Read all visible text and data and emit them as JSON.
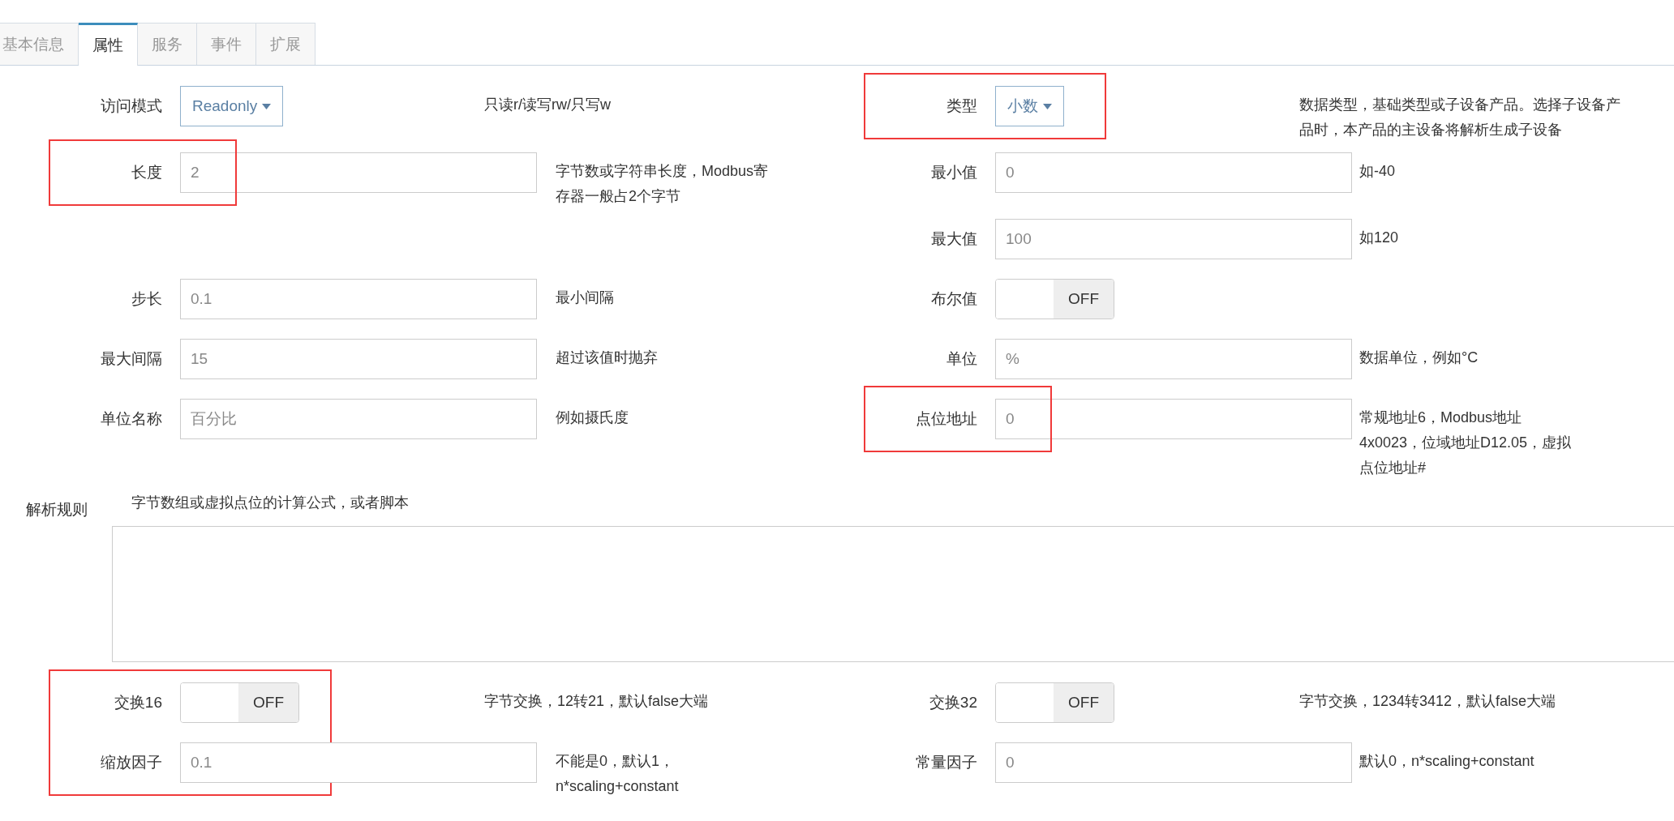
{
  "tabs": [
    {
      "label": "基本信息",
      "selected": false
    },
    {
      "label": "属性",
      "selected": true
    },
    {
      "label": "服务",
      "selected": false
    },
    {
      "label": "事件",
      "selected": false
    },
    {
      "label": "扩展",
      "selected": false
    }
  ],
  "fields_top": [
    {
      "left": {
        "kind": "select",
        "label": "访问模式",
        "value": "Readonly",
        "help": "只读r/读写rw/只写w",
        "highlighted": false
      },
      "right": {
        "kind": "select",
        "label": "类型",
        "value": "小数",
        "help": "数据类型，基础类型或子设备产品。选择子设备产品时，本产品的主设备将解析生成子设备",
        "highlighted": true
      }
    },
    {
      "left": {
        "kind": "input",
        "label": "长度",
        "placeholder": "2",
        "help": "字节数或字符串长度，Modbus寄存器一般占2个字节",
        "highlighted": true
      },
      "right": {
        "kind": "input",
        "label": "最小值",
        "placeholder": "0",
        "help": "如-40",
        "highlighted": false
      }
    },
    {
      "right": {
        "kind": "input",
        "label": "最大值",
        "placeholder": "100",
        "help": "如120",
        "highlighted": false
      }
    },
    {
      "left": {
        "kind": "input",
        "label": "步长",
        "placeholder": "0.1",
        "help": "最小间隔",
        "highlighted": false
      },
      "right": {
        "kind": "toggle",
        "label": "布尔值",
        "on": false,
        "state_label": "OFF",
        "highlighted": false
      }
    },
    {
      "left": {
        "kind": "input",
        "label": "最大间隔",
        "placeholder": "15",
        "help": "超过该值时抛弃",
        "highlighted": false
      },
      "right": {
        "kind": "input",
        "label": "单位",
        "placeholder": "%",
        "help": "数据单位，例如°C",
        "highlighted": false
      }
    },
    {
      "left": {
        "kind": "input",
        "label": "单位名称",
        "placeholder": "百分比",
        "help": "例如摄氏度",
        "highlighted": false
      },
      "right": {
        "kind": "input",
        "label": "点位地址",
        "placeholder": "0",
        "help": "常规地址6，Modbus地址4x0023，位域地址D12.05，虚拟点位地址#",
        "highlighted": true
      }
    }
  ],
  "parse_rule": {
    "label": "解析规则",
    "help": "字节数组或虚拟点位的计算公式，或者脚本"
  },
  "fields_bottom": [
    {
      "left": {
        "kind": "toggle",
        "label": "交换16",
        "on": false,
        "state_label": "OFF",
        "help": "字节交换，12转21，默认false大端",
        "highlighted": true
      },
      "right": {
        "kind": "toggle",
        "label": "交换32",
        "on": false,
        "state_label": "OFF",
        "help": "字节交换，1234转3412，默认false大端",
        "highlighted": false
      }
    },
    {
      "left": {
        "kind": "input",
        "label": "缩放因子",
        "placeholder": "0.1",
        "help": "不能是0，默认1，n*scaling+constant",
        "highlighted": true
      },
      "right": {
        "kind": "input",
        "label": "常量因子",
        "placeholder": "0",
        "help": "默认0，n*scaling+constant",
        "highlighted": false
      }
    }
  ]
}
